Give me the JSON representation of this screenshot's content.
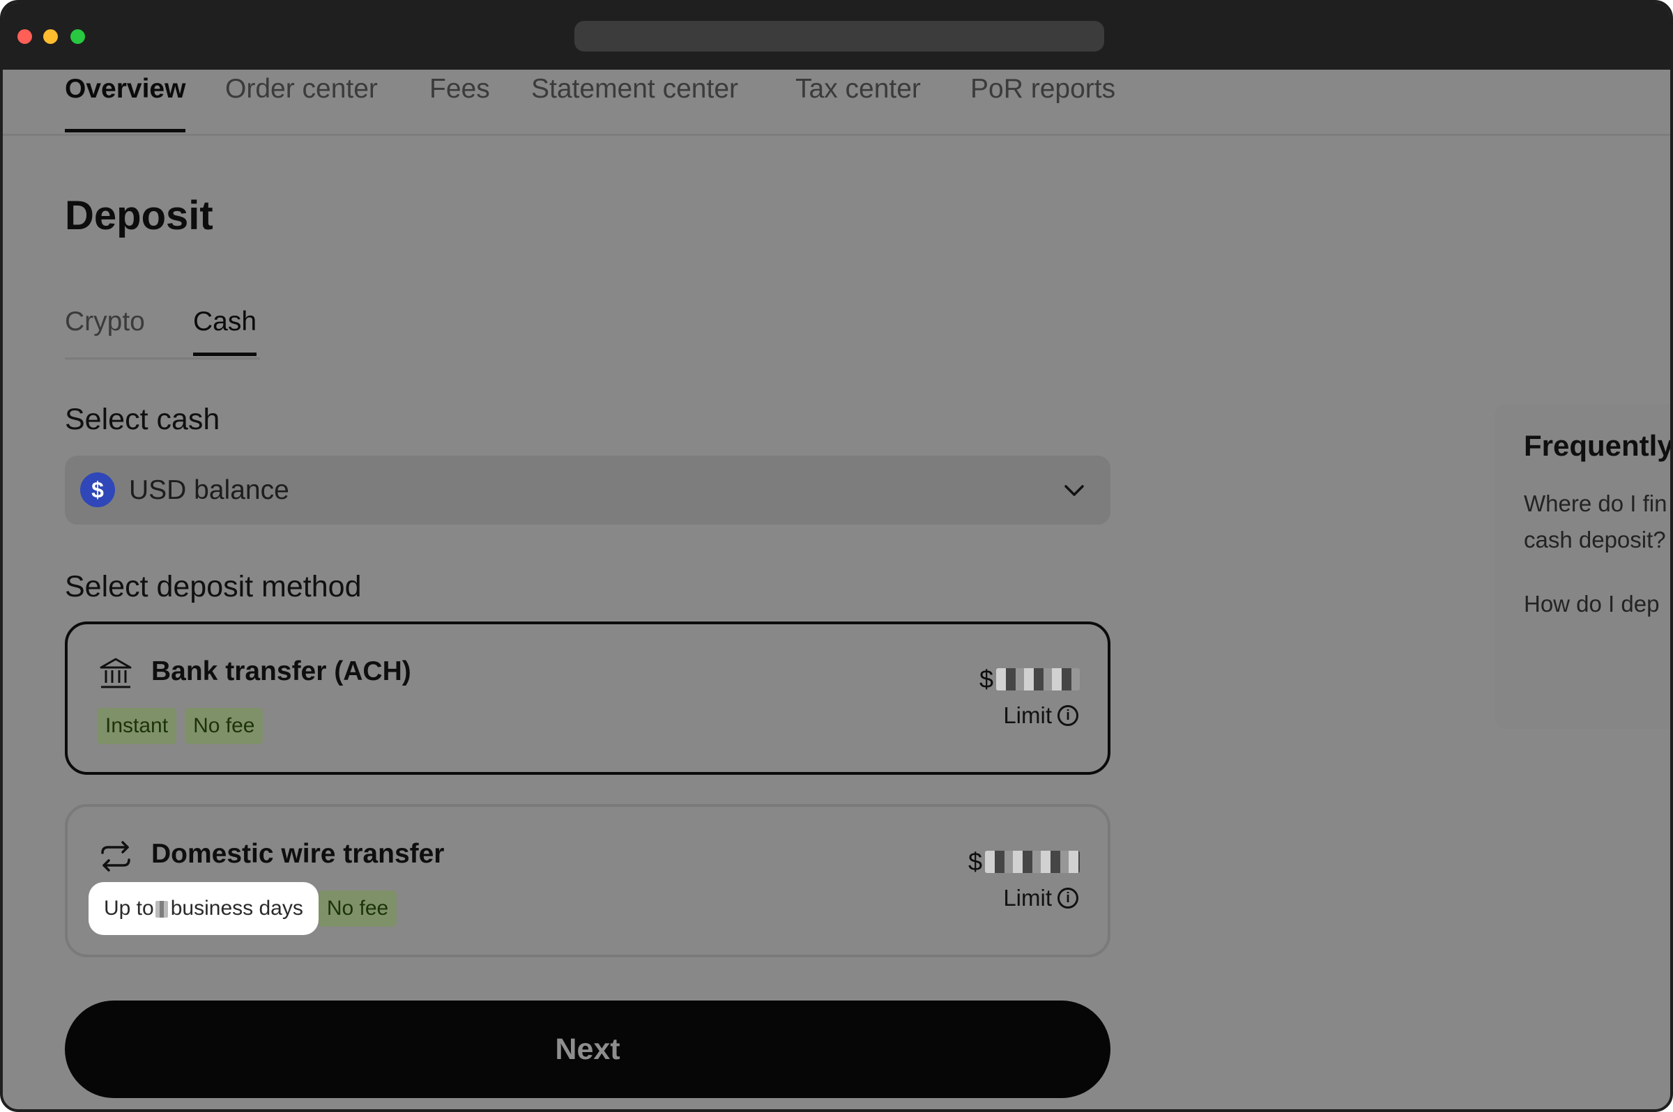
{
  "nav": {
    "tabs": [
      {
        "label": "Overview",
        "active": true
      },
      {
        "label": "Order center"
      },
      {
        "label": "Fees"
      },
      {
        "label": "Statement center"
      },
      {
        "label": "Tax center"
      },
      {
        "label": "PoR reports"
      }
    ]
  },
  "page": {
    "title": "Deposit",
    "sub_tabs": [
      {
        "label": "Crypto"
      },
      {
        "label": "Cash",
        "active": true
      }
    ]
  },
  "select_cash": {
    "label": "Select cash",
    "value": "USD balance",
    "icon": "dollar-icon"
  },
  "deposit_method": {
    "label": "Select deposit method",
    "methods": [
      {
        "title": "Bank transfer (ACH)",
        "icon": "bank-icon",
        "tags": [
          "Instant",
          "No fee"
        ],
        "limit_prefix": "$",
        "limit_label": "Limit",
        "selected": true
      },
      {
        "title": "Domestic wire transfer",
        "icon": "transfer-arrows-icon",
        "tags": [
          "business days",
          "No fee"
        ],
        "tag_prefix": "Up to",
        "limit_prefix": "$",
        "limit_label": "Limit",
        "selected": false
      }
    ]
  },
  "next_button": {
    "label": "Next"
  },
  "faq": {
    "title": "Frequently",
    "questions": [
      "Where do I fin",
      "cash deposit?",
      "How do I dep"
    ]
  },
  "colors": {
    "background_overlay": "#888888",
    "tag_green": "#7f9168",
    "dollar_blue": "#2f47b8",
    "primary": "#060606"
  }
}
